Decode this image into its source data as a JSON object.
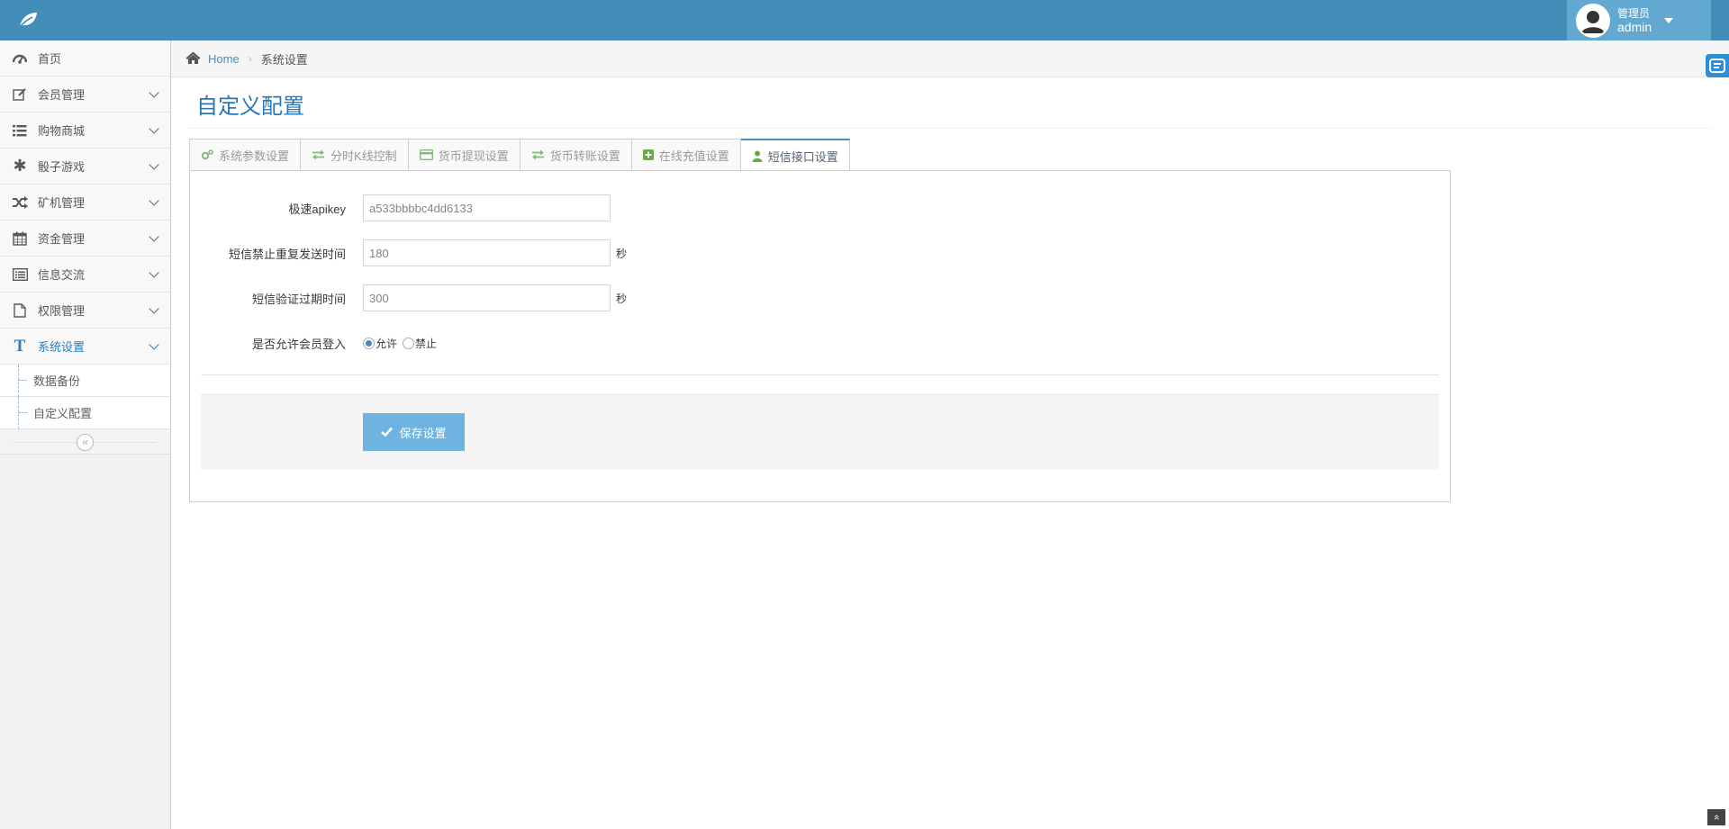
{
  "header": {
    "brand_icon": "leaf-icon",
    "user": {
      "role": "管理员",
      "name": "admin"
    }
  },
  "sidebar": {
    "items": [
      {
        "label": "首页",
        "icon": "dashboard-icon"
      },
      {
        "label": "会员管理",
        "icon": "edit-icon"
      },
      {
        "label": "购物商城",
        "icon": "list-icon"
      },
      {
        "label": "骰子游戏",
        "icon": "asterisk-icon"
      },
      {
        "label": "矿机管理",
        "icon": "shuffle-icon"
      },
      {
        "label": "资金管理",
        "icon": "calendar-icon"
      },
      {
        "label": "信息交流",
        "icon": "list-alt-icon"
      },
      {
        "label": "权限管理",
        "icon": "file-icon"
      },
      {
        "label": "系统设置",
        "icon": "text-icon"
      }
    ],
    "sub_items": [
      {
        "label": "数据备份"
      },
      {
        "label": "自定义配置"
      }
    ],
    "collapse_symbol": "«"
  },
  "breadcrumb": {
    "home": "Home",
    "separator": "›",
    "current": "系统设置"
  },
  "page": {
    "title": "自定义配置"
  },
  "tabs": [
    {
      "label": "系统参数设置",
      "icon": "cogs-icon"
    },
    {
      "label": "分时K线控制",
      "icon": "exchange-icon"
    },
    {
      "label": "货币提现设置",
      "icon": "credit-card-icon"
    },
    {
      "label": "货币转账设置",
      "icon": "exchange-icon"
    },
    {
      "label": "在线充值设置",
      "icon": "plus-square-icon"
    },
    {
      "label": "短信接口设置",
      "icon": "user-icon"
    }
  ],
  "active_tab": "短信接口设置",
  "form": {
    "apikey": {
      "label": "极速apikey",
      "value": "a533bbbbc4dd6133"
    },
    "resend_interval": {
      "label": "短信禁止重复发送时间",
      "value": "180",
      "unit": "秒"
    },
    "expire_time": {
      "label": "短信验证过期时间",
      "value": "300",
      "unit": "秒"
    },
    "allow_login": {
      "label": "是否允许会员登入",
      "options": [
        "允许",
        "禁止"
      ],
      "selected": "允许"
    },
    "save_label": "保存设置"
  },
  "scroll_top_symbol": "«",
  "colors": {
    "navbar": "#438eb9",
    "accent": "#2679b5",
    "save_button": "#6fb3e0"
  }
}
